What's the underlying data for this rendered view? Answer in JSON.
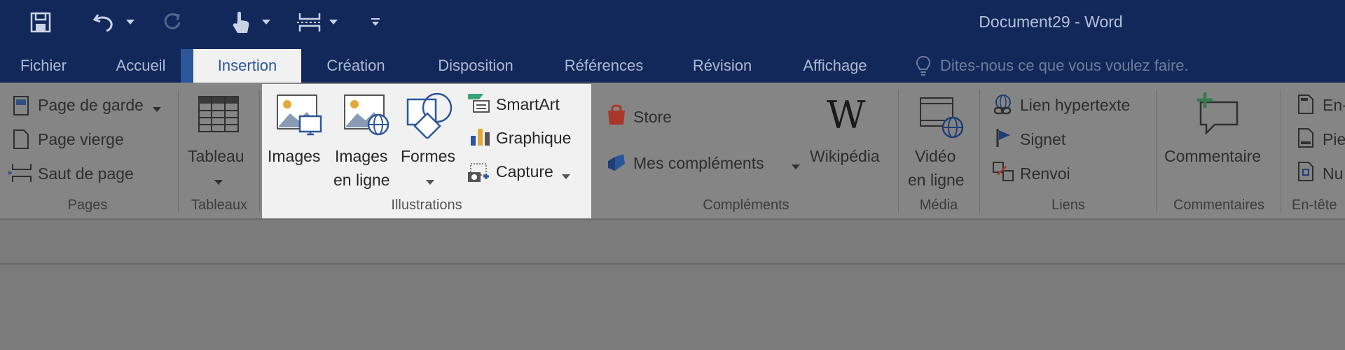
{
  "window": {
    "title": "Document29 - Word"
  },
  "qat": {
    "icons": [
      "save-icon",
      "undo-icon",
      "redo-icon",
      "touch-mode-icon",
      "page-break-icon",
      "customize-qat-icon"
    ]
  },
  "tabs": [
    {
      "id": "fichier",
      "label": "Fichier"
    },
    {
      "id": "accueil",
      "label": "Accueil"
    },
    {
      "id": "insertion",
      "label": "Insertion"
    },
    {
      "id": "creation",
      "label": "Création"
    },
    {
      "id": "disposition",
      "label": "Disposition"
    },
    {
      "id": "references",
      "label": "Références"
    },
    {
      "id": "revision",
      "label": "Révision"
    },
    {
      "id": "affichage",
      "label": "Affichage"
    }
  ],
  "tellme": {
    "placeholder": "Dites-nous ce que vous voulez faire."
  },
  "groups": {
    "pages": {
      "label": "Pages",
      "page_de_garde": "Page de garde",
      "page_vierge": "Page vierge",
      "saut_de_page": "Saut de page"
    },
    "tableaux": {
      "label": "Tableaux",
      "tableau": "Tableau"
    },
    "illustrations": {
      "label": "Illustrations",
      "images": "Images",
      "images_en_ligne_1": "Images",
      "images_en_ligne_2": "en ligne",
      "formes": "Formes",
      "smartart": "SmartArt",
      "graphique": "Graphique",
      "capture": "Capture"
    },
    "complements": {
      "label": "Compléments",
      "store": "Store",
      "mes_complements": "Mes compléments",
      "wikipedia": "Wikipédia"
    },
    "media": {
      "label": "Média",
      "video_1": "Vidéo",
      "video_2": "en ligne"
    },
    "liens": {
      "label": "Liens",
      "lien_hypertexte": "Lien hypertexte",
      "signet": "Signet",
      "renvoi": "Renvoi"
    },
    "commentaires": {
      "label": "Commentaires",
      "commentaire": "Commentaire"
    },
    "entete": {
      "label": "En-tête",
      "item1": "En-",
      "item2": "Pie",
      "item3": "Nu"
    }
  },
  "colors": {
    "titlebar": "#12285a",
    "accent": "#2b579a",
    "ribbon_dimmed": "#858585",
    "highlight_group": "#f1f1f1"
  }
}
